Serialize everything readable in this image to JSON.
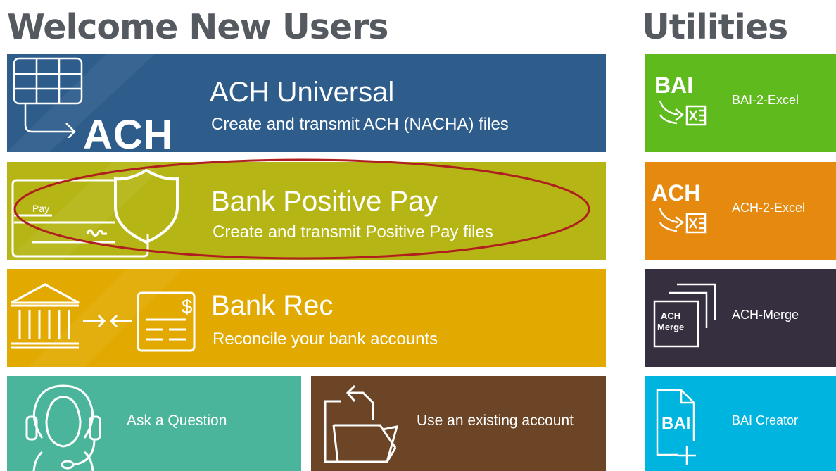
{
  "headings": {
    "left": "Welcome New Users",
    "right": "Utilities"
  },
  "tiles": {
    "ach_universal": {
      "icon_text": "ACH",
      "title": "ACH Universal",
      "subtitle": "Create and transmit ACH (NACHA) files",
      "color": "#2e5d8c"
    },
    "positive_pay": {
      "check_label": "Pay",
      "title": "Bank Positive Pay",
      "subtitle": "Create and transmit Positive Pay files",
      "color": "#b5b515",
      "highlight_color": "#b01f1f"
    },
    "bank_rec": {
      "icon_symbol": "$",
      "title": "Bank Rec",
      "subtitle": "Reconcile your bank accounts",
      "color": "#e2aa00"
    },
    "ask_question": {
      "label": "Ask a Question",
      "color": "#4ab59a"
    },
    "existing_account": {
      "label": "Use an existing account",
      "color": "#6b4526"
    }
  },
  "utilities": [
    {
      "id": "bai2excel",
      "icon_text": "BAI",
      "label": "BAI-2-Excel",
      "color": "#5fba1e"
    },
    {
      "id": "ach2excel",
      "icon_text": "ACH",
      "label": "ACH-2-Excel",
      "color": "#e58a0f"
    },
    {
      "id": "achmerge",
      "icon_text_1": "ACH",
      "icon_text_2": "Merge",
      "label": "ACH-Merge",
      "color": "#352f3f"
    },
    {
      "id": "baicreator",
      "icon_text": "BAI",
      "label": "BAI Creator",
      "color": "#00b4e0"
    }
  ]
}
